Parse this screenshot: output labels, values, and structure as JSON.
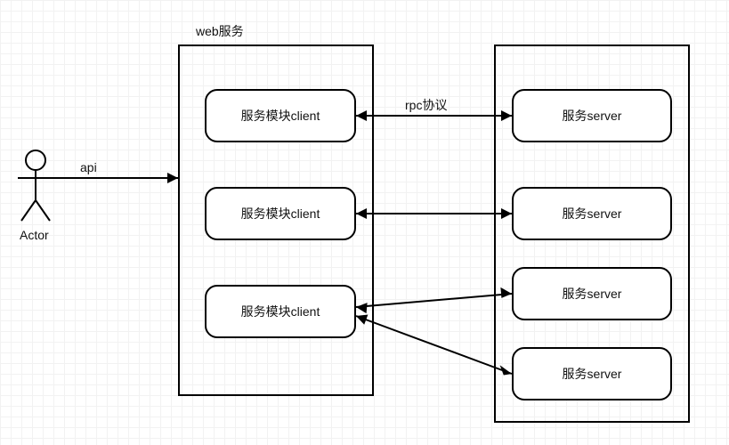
{
  "actor": {
    "label": "Actor"
  },
  "api_label": "api",
  "rpc_label": "rpc协议",
  "web_service": {
    "title": "web服务",
    "clients": [
      {
        "label": "服务模块client"
      },
      {
        "label": "服务模块client"
      },
      {
        "label": "服务模块client"
      }
    ]
  },
  "servers": [
    {
      "label": "服务server"
    },
    {
      "label": "服务server"
    },
    {
      "label": "服务server"
    },
    {
      "label": "服务server"
    }
  ],
  "connections": [
    {
      "from": "actor",
      "to": "web_service",
      "label": "api",
      "type": "arrow"
    },
    {
      "from": "clients.0",
      "to": "servers.0",
      "label": "rpc协议",
      "type": "bidirectional"
    },
    {
      "from": "clients.1",
      "to": "servers.1",
      "type": "bidirectional"
    },
    {
      "from": "clients.2",
      "to": "servers.2",
      "type": "bidirectional"
    },
    {
      "from": "clients.2",
      "to": "servers.3",
      "type": "bidirectional"
    }
  ]
}
